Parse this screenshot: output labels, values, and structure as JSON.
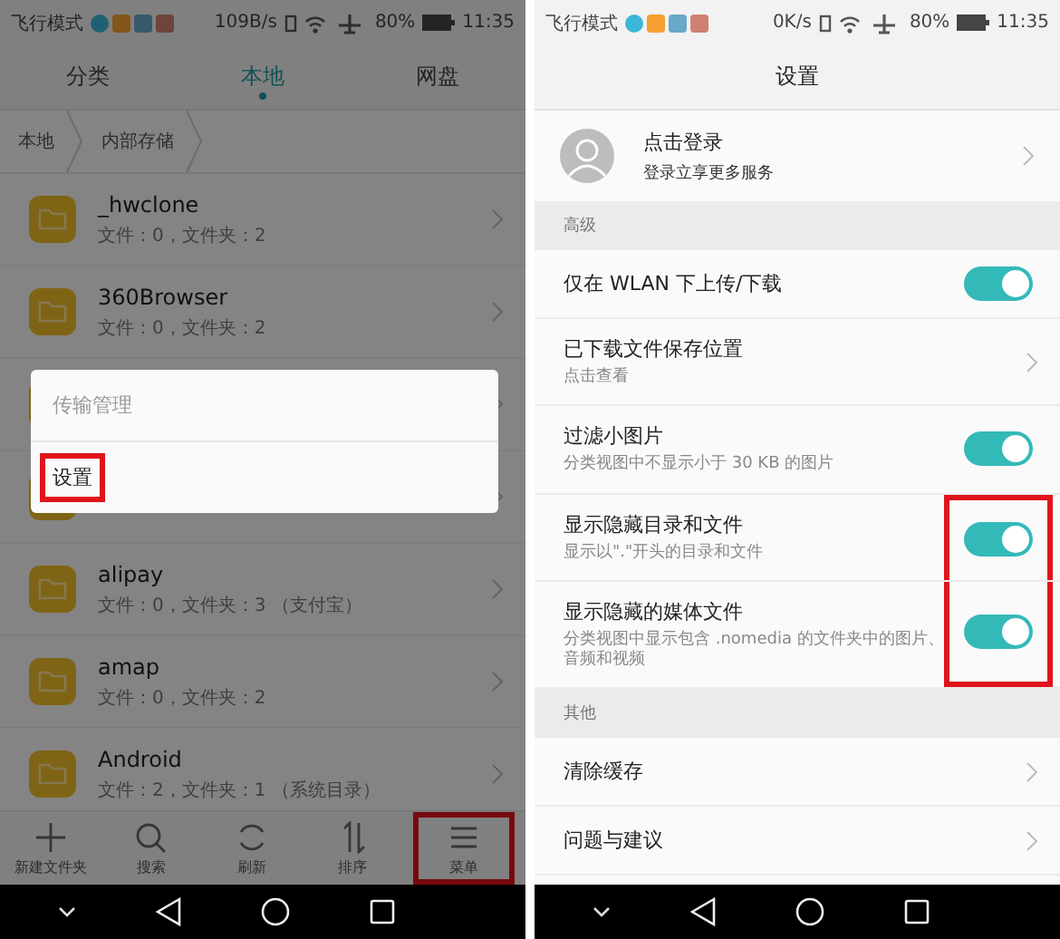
{
  "file_manager": {
    "status_bar": {
      "mode": "飞行模式",
      "speed": "109B/s",
      "battery": "80%",
      "time": "11:35"
    },
    "tabs": [
      {
        "label": "分类",
        "selected": false
      },
      {
        "label": "本地",
        "selected": true
      },
      {
        "label": "网盘",
        "selected": false
      }
    ],
    "breadcrumb": [
      "本地",
      "内部存储"
    ],
    "folders": [
      {
        "kind": "folder",
        "name": "_hwclone",
        "info": "文件：0，文件夹：2"
      },
      {
        "kind": "folder",
        "name": "360Browser",
        "info": "文件：0，文件夹：2"
      },
      {
        "kind": "covered"
      },
      {
        "kind": "covered"
      },
      {
        "kind": "folder",
        "name": "alipay",
        "info": "文件：0，文件夹：3 （支付宝）"
      },
      {
        "kind": "folder",
        "name": "amap",
        "info": "文件：0，文件夹：2"
      },
      {
        "kind": "folder",
        "name": "Android",
        "info": "文件：2，文件夹：1 （系统目录）"
      }
    ],
    "popup_menu": [
      {
        "label": "传输管理",
        "highlighted": false
      },
      {
        "label": "设置",
        "highlighted": true
      }
    ],
    "toolbar": [
      {
        "kind": "plus",
        "label": "新建文件夹",
        "highlighted": false
      },
      {
        "kind": "search",
        "label": "搜索",
        "highlighted": false
      },
      {
        "kind": "refresh",
        "label": "刷新",
        "highlighted": false
      },
      {
        "kind": "sort",
        "label": "排序",
        "highlighted": false
      },
      {
        "kind": "menu",
        "label": "菜单",
        "highlighted": true
      }
    ]
  },
  "settings": {
    "status_bar": {
      "mode": "飞行模式",
      "speed": "0K/s",
      "battery": "80%",
      "time": "11:35"
    },
    "title": "设置",
    "account": {
      "name": "点击登录",
      "subtitle": "登录立享更多服务"
    },
    "sections": [
      {
        "header": "高级",
        "items": [
          {
            "kind": "toggle",
            "title": "仅在 WLAN 下上传/下载",
            "on": true,
            "highlighted": false
          },
          {
            "kind": "link",
            "title": "已下载文件保存位置",
            "subtitle": "点击查看"
          },
          {
            "kind": "toggle",
            "title": "过滤小图片",
            "subtitle": "分类视图中不显示小于 30 KB 的图片",
            "on": true,
            "highlighted": false
          },
          {
            "kind": "toggle",
            "title": "显示隐藏目录和文件",
            "subtitle": "显示以\".\"开头的目录和文件",
            "on": true,
            "highlighted": true
          },
          {
            "kind": "toggle",
            "title": "显示隐藏的媒体文件",
            "subtitle": "分类视图中显示包含 .nomedia 的文件夹中的图片、音频和视频",
            "on": true,
            "highlighted": true
          }
        ]
      },
      {
        "header": "其他",
        "items": [
          {
            "kind": "link",
            "title": "清除缓存"
          },
          {
            "kind": "link",
            "title": "问题与建议"
          }
        ]
      }
    ]
  }
}
